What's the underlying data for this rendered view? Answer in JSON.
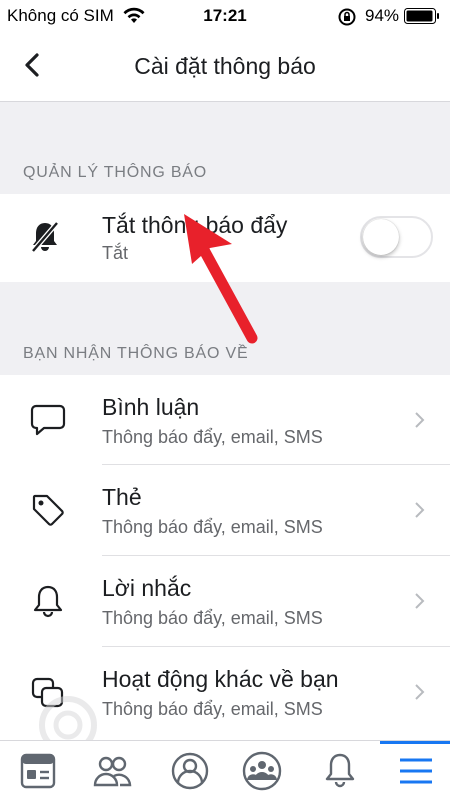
{
  "status_bar": {
    "carrier": "Không có SIM",
    "time": "17:21",
    "battery": "94%"
  },
  "nav": {
    "title": "Cài đặt thông báo"
  },
  "section_manage": {
    "title": "QUẢN LÝ THÔNG BÁO"
  },
  "push_toggle": {
    "label": "Tắt thông báo đẩy",
    "status": "Tắt",
    "checked": false
  },
  "section_receive": {
    "title": "BẠN NHẬN THÔNG BÁO VỀ"
  },
  "items": [
    {
      "label": "Bình luận",
      "sub": "Thông báo đẩy, email, SMS",
      "icon": "comment-icon"
    },
    {
      "label": "Thẻ",
      "sub": "Thông báo đẩy, email, SMS",
      "icon": "tag-icon"
    },
    {
      "label": "Lời nhắc",
      "sub": "Thông báo đẩy, email, SMS",
      "icon": "bell-icon"
    },
    {
      "label": "Hoạt động khác về bạn",
      "sub": "Thông báo đẩy, email, SMS",
      "icon": "overlap-squares-icon"
    }
  ],
  "tabs": [
    "news-feed-icon",
    "friends-icon",
    "profile-icon",
    "groups-icon",
    "notifications-icon",
    "menu-icon"
  ],
  "colors": {
    "accent": "#1877f2",
    "annotation_arrow": "#e8212b"
  }
}
